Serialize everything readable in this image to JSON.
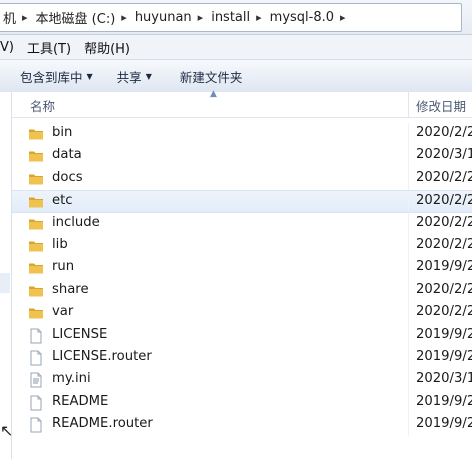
{
  "address": {
    "crumbs": [
      "机",
      "本地磁盘 (C:)",
      "huyunan",
      "install",
      "mysql-8.0"
    ]
  },
  "menu": {
    "items": [
      "V)",
      "工具(T)",
      "帮助(H)"
    ]
  },
  "toolbar": {
    "include_in_library": "包含到库中",
    "share": "共享",
    "new_folder": "新建文件夹"
  },
  "columns": {
    "name": "名称",
    "date_modified": "修改日期"
  },
  "files": [
    {
      "name": "bin",
      "type": "folder",
      "date": "2020/2/2"
    },
    {
      "name": "data",
      "type": "folder",
      "date": "2020/3/1"
    },
    {
      "name": "docs",
      "type": "folder",
      "date": "2020/2/2"
    },
    {
      "name": "etc",
      "type": "folder",
      "date": "2020/2/2",
      "selected": true
    },
    {
      "name": "include",
      "type": "folder",
      "date": "2020/2/2"
    },
    {
      "name": "lib",
      "type": "folder",
      "date": "2020/2/2"
    },
    {
      "name": "run",
      "type": "folder",
      "date": "2019/9/2"
    },
    {
      "name": "share",
      "type": "folder",
      "date": "2020/2/2"
    },
    {
      "name": "var",
      "type": "folder",
      "date": "2020/2/2"
    },
    {
      "name": "LICENSE",
      "type": "file",
      "date": "2019/9/2"
    },
    {
      "name": "LICENSE.router",
      "type": "file",
      "date": "2019/9/2"
    },
    {
      "name": "my.ini",
      "type": "ini",
      "date": "2020/3/1"
    },
    {
      "name": "README",
      "type": "file",
      "date": "2019/9/2"
    },
    {
      "name": "README.router",
      "type": "file",
      "date": "2019/9/2"
    }
  ],
  "colors": {
    "folder": "#e8b93c",
    "selection": "#e5eefa",
    "header_text": "#4b5a70"
  }
}
